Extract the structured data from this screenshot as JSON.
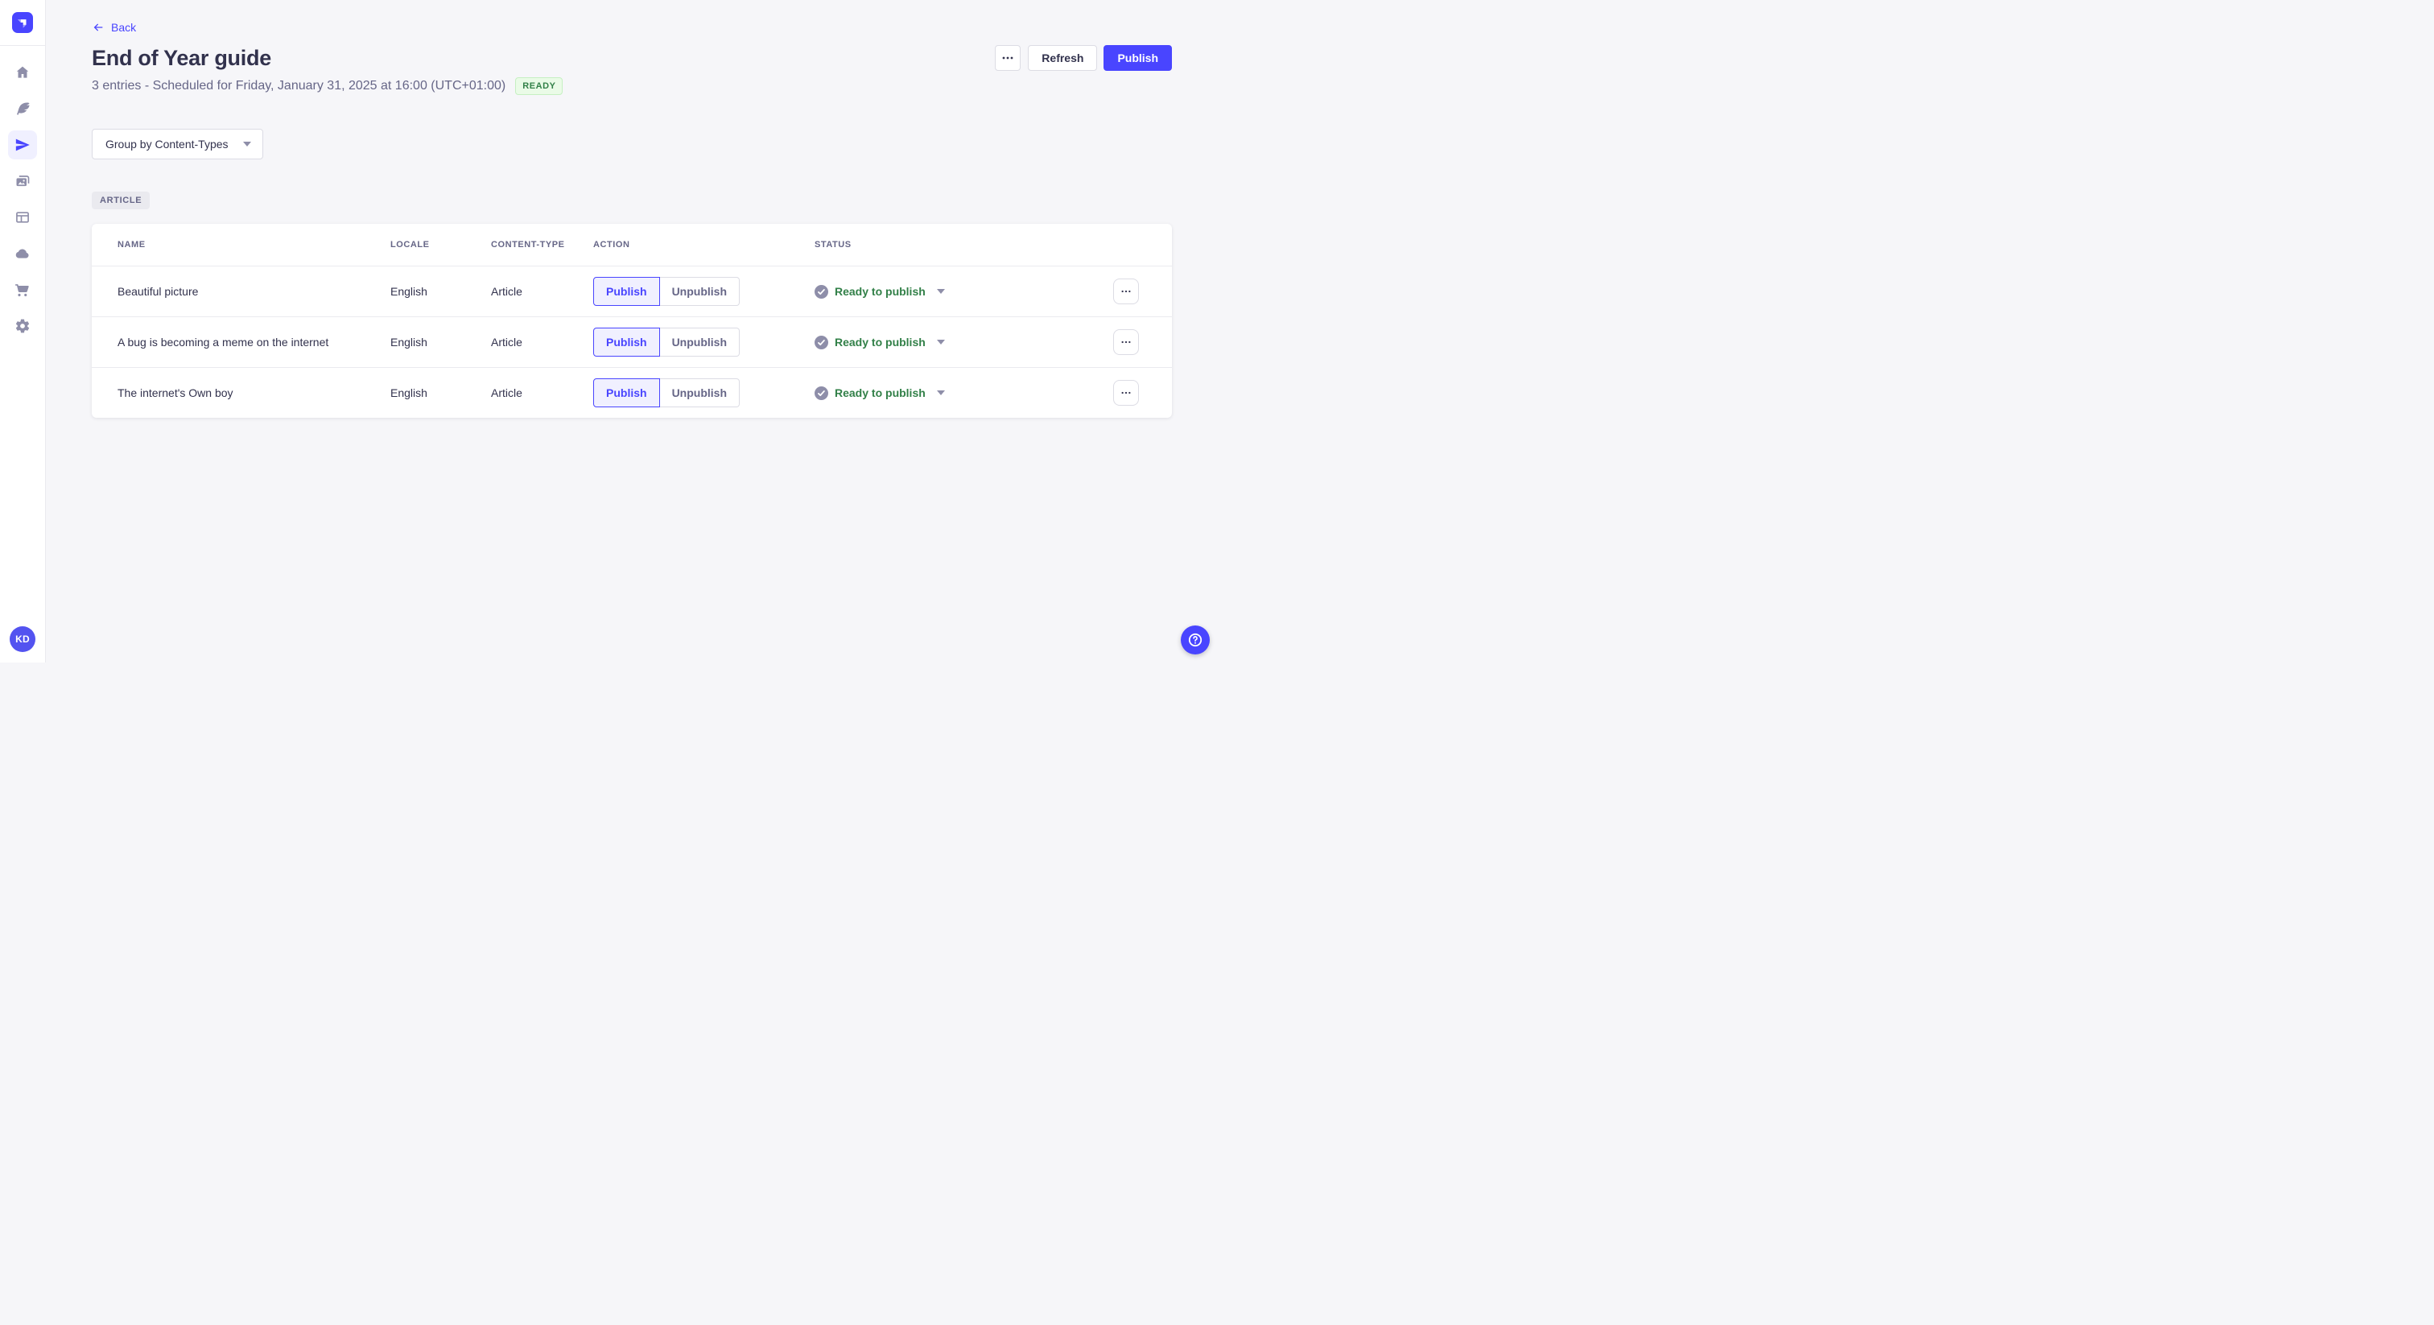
{
  "colors": {
    "primary": "#4945ff",
    "primary_light_bg": "#f0f0ff",
    "text_dark": "#32324d",
    "text_muted": "#666687",
    "icon_gray": "#8e8ea9",
    "border": "#dcdce4",
    "divider": "#eaeaef",
    "page_bg": "#f6f6f9",
    "success_text": "#328048",
    "success_bg": "#eafbe7",
    "success_border": "#c6f0c2"
  },
  "sidebar": {
    "logo_icon": "strapi-logo",
    "items": [
      {
        "icon": "home"
      },
      {
        "icon": "feather"
      },
      {
        "icon": "paper-plane",
        "active": true
      },
      {
        "icon": "media-library"
      },
      {
        "icon": "layout"
      },
      {
        "icon": "cloud"
      },
      {
        "icon": "cart"
      },
      {
        "icon": "gear"
      }
    ],
    "avatar_initials": "KD"
  },
  "header": {
    "back": "Back",
    "title": "End of Year guide",
    "subtitle": "3 entries - Scheduled for Friday, January 31, 2025 at 16:00 (UTC+01:00)",
    "status_badge": "READY",
    "refresh": "Refresh",
    "publish": "Publish"
  },
  "toolbar": {
    "group_by": "Group by Content-Types"
  },
  "group": {
    "label": "ARTICLE"
  },
  "table": {
    "columns": [
      "NAME",
      "LOCALE",
      "CONTENT-TYPE",
      "ACTION",
      "STATUS"
    ],
    "actions": {
      "publish": "Publish",
      "unpublish": "Unpublish"
    },
    "rows": [
      {
        "name": "Beautiful picture",
        "locale": "English",
        "content_type": "Article",
        "status": "Ready to publish"
      },
      {
        "name": "A bug is becoming a meme on the internet",
        "locale": "English",
        "content_type": "Article",
        "status": "Ready to publish"
      },
      {
        "name": "The internet's Own boy",
        "locale": "English",
        "content_type": "Article",
        "status": "Ready to publish"
      }
    ]
  }
}
